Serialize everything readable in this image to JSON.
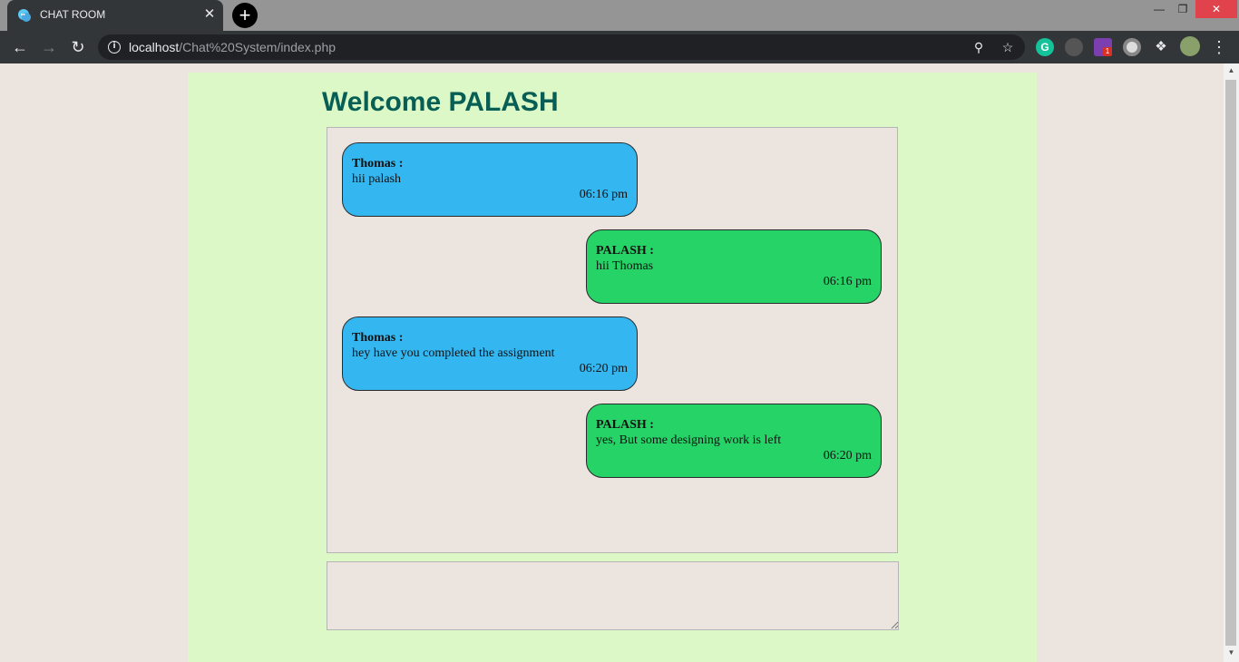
{
  "browser": {
    "tab_title": "CHAT ROOM",
    "url_host": "localhost",
    "url_path": "/Chat%20System/index.php",
    "extension_badge": "1"
  },
  "page": {
    "welcome_text": "Welcome PALASH"
  },
  "messages": [
    {
      "sender": "Thomas :",
      "text": "hii palash",
      "time": "06:16 pm",
      "direction": "incoming"
    },
    {
      "sender": "PALASH :",
      "text": "hii Thomas",
      "time": "06:16 pm",
      "direction": "outgoing"
    },
    {
      "sender": "Thomas :",
      "text": "hey have you completed the assignment",
      "time": "06:20 pm",
      "direction": "incoming"
    },
    {
      "sender": "PALASH :",
      "text": "yes, But some designing work is left",
      "time": "06:20 pm",
      "direction": "outgoing"
    }
  ],
  "message_input": {
    "value": "",
    "placeholder": ""
  },
  "colors": {
    "incoming_bubble": "#34b7f1",
    "outgoing_bubble": "#25d366",
    "page_container": "#dcf8c6",
    "heading": "#075e54"
  }
}
